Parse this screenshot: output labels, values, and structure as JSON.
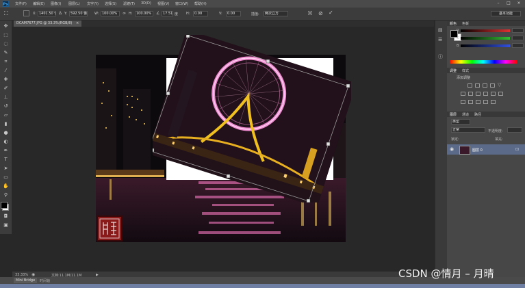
{
  "app": {
    "logo": "Ps"
  },
  "menu": [
    "文件(F)",
    "编辑(E)",
    "图像(I)",
    "图层(L)",
    "文字(Y)",
    "选择(S)",
    "滤镜(T)",
    "3D(D)",
    "视图(V)",
    "窗口(W)",
    "帮助(H)"
  ],
  "window_controls": [
    "–",
    "□",
    "×"
  ],
  "options": {
    "x_value": "1401.50 像",
    "y_value": "592.50 像",
    "w_label": "W:",
    "w_value": "100.00%",
    "h_label": "H:",
    "h_value": "100.00%",
    "angle_value": "17.51",
    "angle_unit": "度",
    "hskew_label": "H:",
    "hskew_value": "0.00",
    "vskew_label": "V:",
    "vskew_value": "0.00",
    "interp_label": "插值:",
    "interp_value": "两次立方",
    "workspace": "基本功能"
  },
  "document": {
    "tab_label": "DCAM7677.JPG @ 33.3%(RGB/8)",
    "close": "×"
  },
  "status": {
    "zoom": "33.33%",
    "doc_info": "文档:11.1M/11.1M",
    "arrow": "▶"
  },
  "bottom": {
    "mini_bridge": "Mini Bridge",
    "timeline": "时间轴"
  },
  "panels": {
    "color_tabs": [
      "颜色",
      "色板"
    ],
    "color_sliders": [
      {
        "label": "R",
        "color": "#e03030",
        "value": ""
      },
      {
        "label": "G",
        "color": "#30c030",
        "value": ""
      },
      {
        "label": "B",
        "color": "#3050e0",
        "value": ""
      }
    ],
    "adjust_tabs": [
      "调整",
      "样式"
    ],
    "adjust_title": "添加调整",
    "layer_tabs": [
      "图层",
      "通道",
      "路径"
    ],
    "layer_kind": "类型",
    "blend_mode": "正常",
    "opacity_label": "不透明度:",
    "opacity_value": "",
    "lock_label": "锁定:",
    "fill_label": "填充:",
    "layer_name": "图层 0"
  },
  "watermark": "CSDN @情月 – 月晴",
  "colors": {
    "foreground": "#000000",
    "background": "#ffffff",
    "accent": "#31a8ff"
  }
}
